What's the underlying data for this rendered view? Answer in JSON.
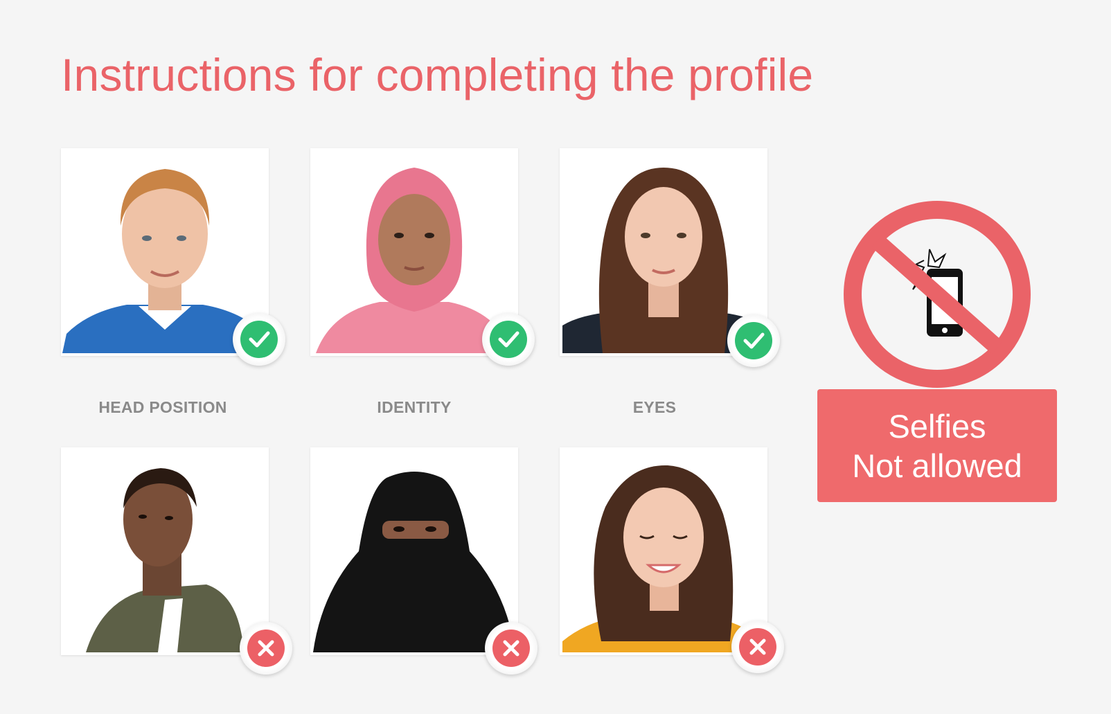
{
  "title": "Instructions for completing the profile",
  "colors": {
    "accent": "#ea6368",
    "ok": "#2fbe72",
    "bad": "#ec6066",
    "caption": "#8a8a8a",
    "background": "#f5f5f5"
  },
  "allowed_examples": [
    {
      "caption": "HEAD POSITION",
      "status_icon": "check-icon"
    },
    {
      "caption": "IDENTITY",
      "status_icon": "check-icon"
    },
    {
      "caption": "EYES",
      "status_icon": "check-icon"
    }
  ],
  "rejected_examples": [
    {
      "status_icon": "cross-icon"
    },
    {
      "status_icon": "cross-icon"
    },
    {
      "status_icon": "cross-icon"
    }
  ],
  "selfie_notice": {
    "icon": "no-selfie-icon",
    "line1": "Selfies",
    "line2": "Not allowed"
  }
}
